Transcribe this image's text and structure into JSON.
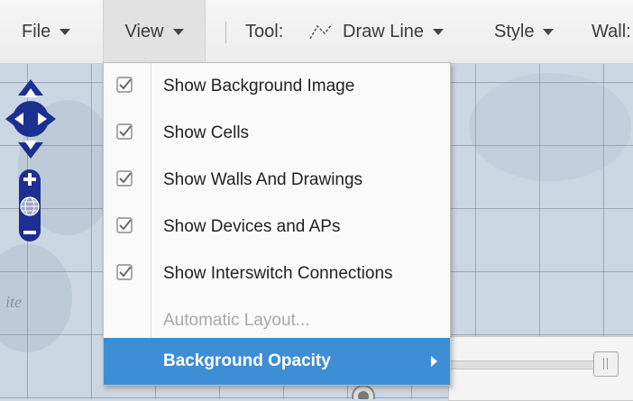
{
  "toolbar": {
    "file_label": "File",
    "view_label": "View",
    "tool_label": "Tool:",
    "tool_value": "Draw Line",
    "style_label": "Style",
    "wall_label": "Wall:"
  },
  "map": {
    "label": "ite"
  },
  "view_menu": {
    "items": [
      {
        "label": "Show Background Image",
        "checked": true
      },
      {
        "label": "Show Cells",
        "checked": true
      },
      {
        "label": "Show Walls And Drawings",
        "checked": true
      },
      {
        "label": "Show Devices and APs",
        "checked": true
      },
      {
        "label": "Show Interswitch Connections",
        "checked": true
      },
      {
        "label": "Automatic Layout...",
        "disabled": true
      },
      {
        "label": "Background Opacity",
        "highlighted": true,
        "submenu": true
      }
    ]
  },
  "colors": {
    "accent": "#3e8ed6",
    "nav_control": "#1c2f93",
    "map_bg": "#cbd7e2"
  },
  "icons": [
    "caret-down-icon",
    "draw-line-icon",
    "checkbox-checked-icon",
    "pan-arrows-icon",
    "zoom-in-icon",
    "globe-icon",
    "zoom-out-icon",
    "submenu-arrow-icon"
  ]
}
